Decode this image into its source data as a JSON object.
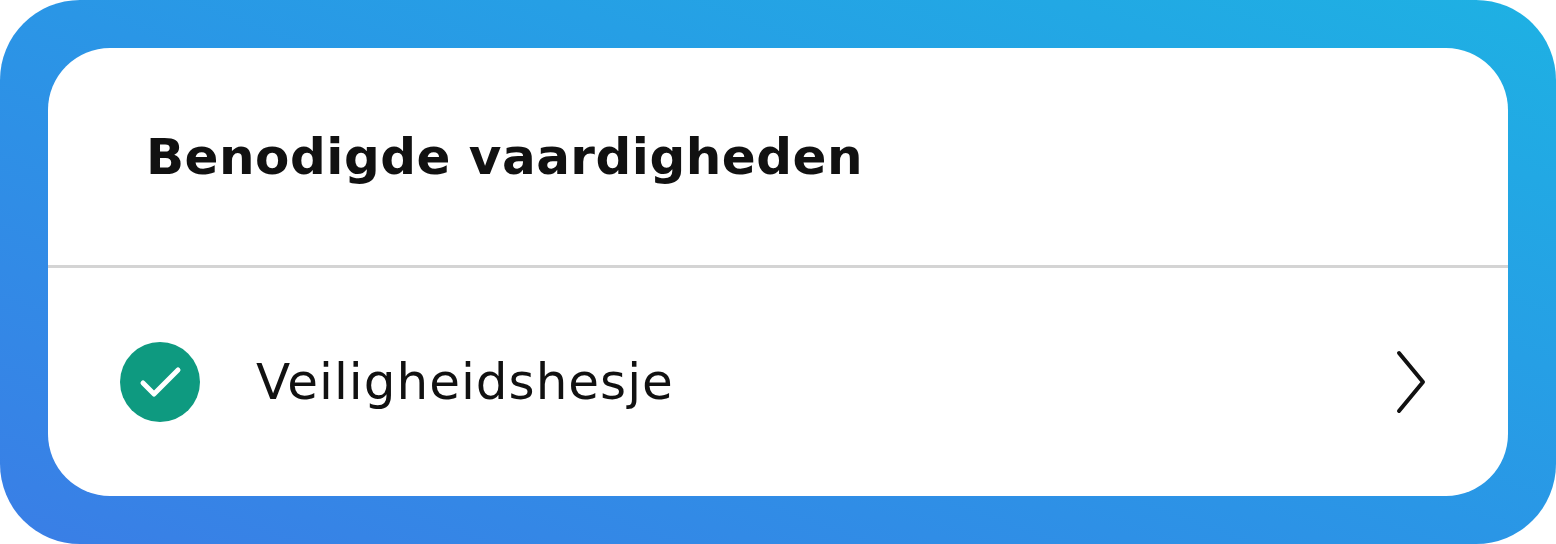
{
  "card": {
    "title": "Benodigde vaardigheden",
    "items": [
      {
        "label": "Veiligheidshesje",
        "checked": true
      }
    ]
  }
}
